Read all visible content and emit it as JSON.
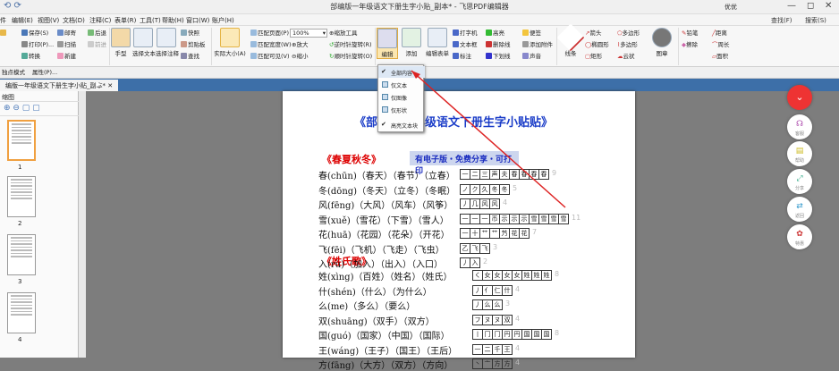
{
  "window": {
    "title": "部编版一年级语文下册生字小贴_副本* - 飞思PDF编辑器",
    "user_label": "优优",
    "minimize": "—",
    "restore": "◻",
    "close": "✕"
  },
  "menu": {
    "items": [
      "件",
      "编辑(E)",
      "视图(V)",
      "文档(D)",
      "注释(C)",
      "表单(R)",
      "工具(T)",
      "帮助(H)",
      "窗口(W)",
      "账户(H)"
    ],
    "right_items": [
      "查找(F)",
      "搜索(S)"
    ]
  },
  "ribbon": {
    "file": {
      "save": "保存(S)",
      "print": "打印(P)...",
      "convert": "转换"
    },
    "email": {
      "mail": "邮寄",
      "back": "后退",
      "scan": "扫描",
      "forward": "前进",
      "new": "新建"
    },
    "tools": {
      "hand": "手型",
      "select_text": "选择文本",
      "select_annot": "选择注释"
    },
    "snapshot": {
      "snap": "快照",
      "clipboard": "剪贴板",
      "find": "查找"
    },
    "view": {
      "actual_size": "实际大小(A)",
      "fit_page": "匹配页面(P)",
      "fit_width": "匹配宽度(W)",
      "fit_visible": "匹配可见(V)",
      "zoom": "100%",
      "zoom_in": "放大",
      "zoom_out": "缩小"
    },
    "rotate": {
      "zoom_tool": "缩放工具",
      "rotate_ccw": "逆时针旋转(R)",
      "rotate_cw": "顺时针旋转(O)"
    },
    "edit": {
      "edit": "编辑",
      "add": "添加",
      "edit_form": "编辑表单"
    },
    "typewriter": {
      "typewriter": "打字机",
      "textbox": "文本框",
      "callout": "标注",
      "highlight": "高亮",
      "strikeout": "删除线",
      "underline": "下划线",
      "note": "便签",
      "attach": "添加附件",
      "sound": "声音"
    },
    "shapes": {
      "line": "线条",
      "arrow": "箭头",
      "ellipse": "椭圆形",
      "rect": "矩形",
      "polygon": "多边形",
      "polyline": "多边形",
      "cloud": "云状",
      "stamp": "图章"
    },
    "draw": {
      "pencil": "铅笔",
      "eraser": "擦除",
      "distance": "距离",
      "perimeter": "周长",
      "area": "面积"
    }
  },
  "subbar": {
    "mode": "独点模式",
    "props": "属性(P)..."
  },
  "tab": {
    "label": "编版一年级语文下册生字小贴_副本*"
  },
  "sidebar": {
    "header": "缩图",
    "pages": [
      "1",
      "2",
      "3",
      "4"
    ]
  },
  "context_menu": {
    "items": [
      "全部内容",
      "仅文本",
      "仅图像",
      "仅形状",
      "高亮文本块"
    ]
  },
  "doc": {
    "title": "《部编版一年级语文下册生字小贴贴》",
    "title_left": "《部",
    "title_right": "年级语文下册生字小贴贴》",
    "sec1": "《春夏秋冬》",
    "banner": "有电子版・免费分享・可打印",
    "sec2": "《姓氏歌》",
    "rows1": [
      {
        "text": "春(chūn)（春天）（春节）（立春）",
        "chars": [
          "一",
          "二",
          "三",
          "声",
          "夫",
          "春",
          "春",
          "春",
          "春"
        ],
        "n": "9"
      },
      {
        "text": "冬(dōng)（冬天）（立冬）（冬眠）",
        "chars": [
          "ノ",
          "ク",
          "久",
          "冬",
          "冬"
        ],
        "n": "5"
      },
      {
        "text": "风(fēng)（大风）（风车）（风筝）",
        "chars": [
          "丿",
          "几",
          "风",
          "风"
        ],
        "n": "4"
      },
      {
        "text": "雪(xuě)（雪花）（下雪）（雪人）",
        "chars": [
          "一",
          "一",
          "一",
          "币",
          "示",
          "示",
          "示",
          "雪",
          "雪",
          "雪",
          "雪"
        ],
        "n": "11"
      },
      {
        "text": "花(huā)（花园）（花朵）（开花）",
        "chars": [
          "一",
          "十",
          "艹",
          "艹",
          "艿",
          "花",
          "花"
        ],
        "n": "7"
      },
      {
        "text": "飞(fēi)（飞机）（飞走）（飞虫）",
        "chars": [
          "乙",
          "飞",
          "飞"
        ],
        "n": "3"
      },
      {
        "text": "入(rù)（加入）（出入）（入口）",
        "chars": [
          "丿",
          "入"
        ],
        "n": "2"
      }
    ],
    "rows2": [
      {
        "text": "姓(xìng)（百姓）（姓名）（姓氏）",
        "chars": [
          "く",
          "女",
          "女",
          "女",
          "女",
          "姓",
          "姓",
          "姓"
        ],
        "n": "8"
      },
      {
        "text": "什(shén)（什么）（为什么）",
        "chars": [
          "丿",
          "亻",
          "仁",
          "什"
        ],
        "n": "4"
      },
      {
        "text": "么(me)（多么）（要么）",
        "chars": [
          "丿",
          "么",
          "么"
        ],
        "n": "3"
      },
      {
        "text": "双(shuāng)（双手）（双方）",
        "chars": [
          "フ",
          "ヌ",
          "ヌ",
          "双"
        ],
        "n": "4"
      },
      {
        "text": "国(guó)（国家）（中国）（国际）",
        "chars": [
          "丨",
          "冂",
          "冂",
          "円",
          "円",
          "国",
          "国",
          "国"
        ],
        "n": "8"
      },
      {
        "text": "王(wáng)（王子）（国王）（王后）",
        "chars": [
          "一",
          "二",
          "千",
          "王"
        ],
        "n": "4"
      },
      {
        "text": "方(fāng)（大方）（双方）（方向）",
        "chars": [
          "丶",
          "亠",
          "方",
          "方"
        ],
        "n": "4"
      }
    ]
  },
  "fab": {
    "items": [
      "返回",
      "客服",
      "帮助",
      "分享",
      "特惠"
    ]
  }
}
